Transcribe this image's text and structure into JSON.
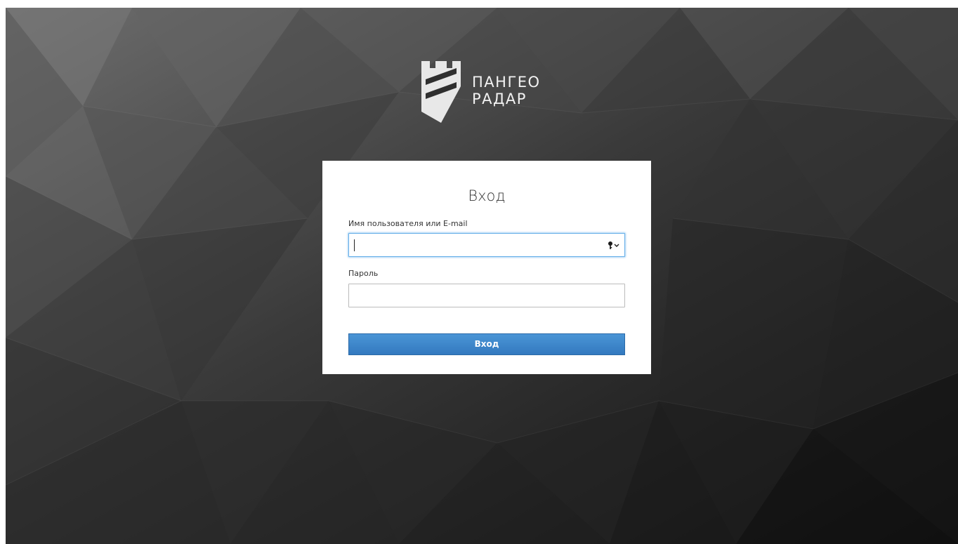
{
  "brand": {
    "line1": "ПАНГЕО",
    "line2": "РАДАР",
    "logo_icon": "castle-tower-shield-icon"
  },
  "login": {
    "title": "Вход",
    "username_label": "Имя пользователя или E-mail",
    "username_value": "",
    "password_label": "Пароль",
    "password_value": "",
    "submit_label": "Вход",
    "autofill_icon": "key-autofill-icon"
  },
  "colors": {
    "primary_button": "#3b85c9",
    "focus_border": "#66afe9",
    "background": "#2a2a2a",
    "card": "#ffffff"
  }
}
